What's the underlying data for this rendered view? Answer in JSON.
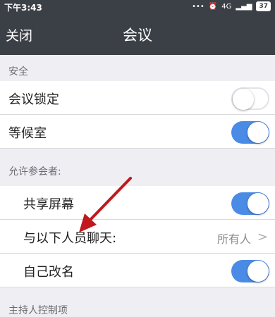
{
  "status_bar": {
    "time": "下午3:43",
    "network": "4G",
    "battery": "37"
  },
  "nav": {
    "close_label": "关闭",
    "title": "会议"
  },
  "sections": {
    "security": "安全",
    "allow_participants": "允许参会者:",
    "host_controls": "主持人控制项"
  },
  "rows": {
    "meeting_lock": {
      "label": "会议锁定",
      "enabled": false
    },
    "waiting_room": {
      "label": "等候室",
      "enabled": true
    },
    "share_screen": {
      "label": "共享屏幕",
      "enabled": true
    },
    "chat_with": {
      "label": "与以下人员聊天:",
      "value": "所有人"
    },
    "rename_self": {
      "label": "自己改名",
      "enabled": true
    }
  },
  "colors": {
    "nav_background": "#3b3f46",
    "toggle_on": "#4a8be6",
    "annotation_arrow": "#c0181c"
  }
}
